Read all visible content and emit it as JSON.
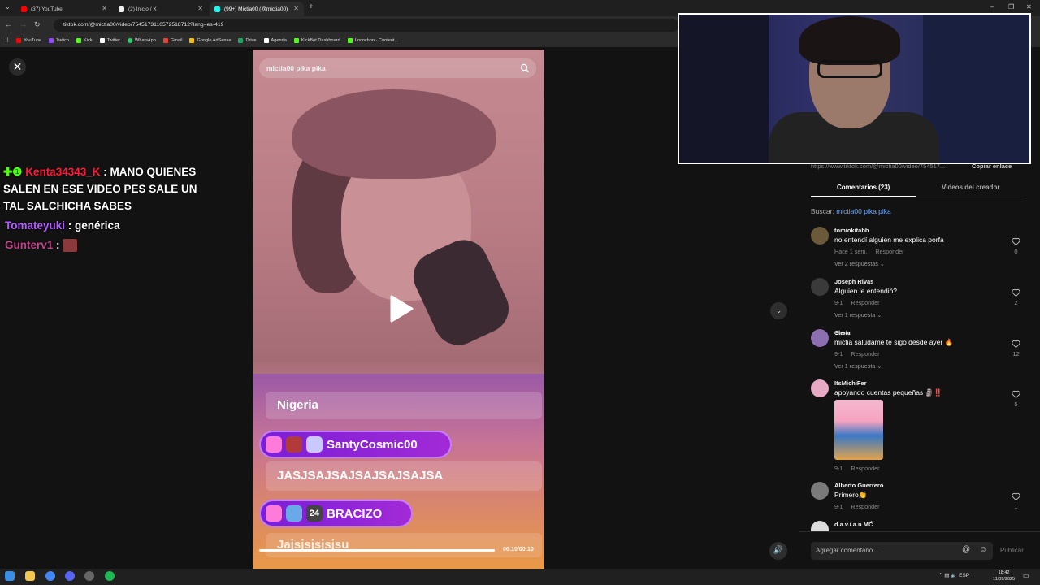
{
  "browser": {
    "tabs": [
      {
        "label": "(37) YouTube",
        "color": "#ff0000",
        "active": false
      },
      {
        "label": "(2) Inicio / X",
        "color": "#ffffff",
        "active": false
      },
      {
        "label": "(99+) Mictia00 (@mictia00)",
        "color": "#25f4ee",
        "active": true
      }
    ],
    "new_tab": "+",
    "url": "tiktok.com/@mictia00/video/7545173110572518712?lang=es-419",
    "bookmarks": [
      {
        "label": "YouTube",
        "color": "#ff0000"
      },
      {
        "label": "Twitch",
        "color": "#9146ff"
      },
      {
        "label": "Kick",
        "color": "#53fc18"
      },
      {
        "label": "Twitter",
        "color": "#ffffff"
      },
      {
        "label": "WhatsApp",
        "color": "#25d366"
      },
      {
        "label": "Gmail",
        "color": "#ea4335"
      },
      {
        "label": "Google AdSense",
        "color": "#fbbc04"
      },
      {
        "label": "Drive",
        "color": "#1fa463"
      },
      {
        "label": "Agenda",
        "color": "#ffffff"
      },
      {
        "label": "KickBot Dashboard",
        "color": "#53fc18"
      },
      {
        "label": "Locochon · Content...",
        "color": "#53fc18"
      }
    ]
  },
  "chat": [
    {
      "user": "Kenta34343_K",
      "user_color": "#ff1a3c",
      "text": ": MANO QUIENES",
      "badges": "✚❶"
    },
    {
      "user": "",
      "user_color": "#ffffff",
      "text": "SALEN EN ESE VIDEO PES SALE UN"
    },
    {
      "user": "",
      "user_color": "#ffffff",
      "text": "TAL SALCHICHA SABES"
    },
    {
      "user": "Tomateyuki",
      "user_color": "#b25cff",
      "text": ": genérica"
    },
    {
      "user": "Gunterv1",
      "user_color": "#c0468d",
      "text": ":"
    }
  ],
  "video": {
    "search_text": "mictia00 pika pika",
    "alert_messages": [
      {
        "type": "text",
        "text": "Nigeria"
      },
      {
        "type": "user",
        "text": "SantyCosmic00"
      },
      {
        "type": "text",
        "text": "JASJSAJSAJSAJSAJSAJSA"
      },
      {
        "type": "user",
        "text": "BRACIZO",
        "badge_text": "24"
      },
      {
        "type": "text",
        "text": "Jajsjsjsjsjsu"
      }
    ],
    "time": "00:10/00:10",
    "progress": 1.0
  },
  "panel": {
    "link": "https://www.tiktok.com/@mictia00/video/754517...",
    "copy_link": "Copiar enlace",
    "tab_comments": "Comentarios (23)",
    "tab_creator": "Videos del creador",
    "search_label": "Buscar: ",
    "search_term": "mictia00 pika pika",
    "comments": [
      {
        "user": "tomiokitabb",
        "text": "no entendí alguien me explica porfa",
        "date": "Hace 1 sem.",
        "reply": "Responder",
        "replies": "Ver 2 respuestas ⌄",
        "likes": "0",
        "avatar": "#6b5a3a"
      },
      {
        "user": "Joseph Rivas",
        "text": "Alguien le entendió?",
        "date": "9-1",
        "reply": "Responder",
        "replies": "Ver 1 respuesta ⌄",
        "likes": "2",
        "avatar": "#3a3a3a"
      },
      {
        "user": "𝕾𝖎𝖊𝖘𝖙𝖆",
        "text": "mictia salúdame te sigo desde ayer 🔥",
        "date": "9-1",
        "reply": "Responder",
        "replies": "Ver 1 respuesta ⌄",
        "likes": "12",
        "avatar": "#8c6fb0"
      },
      {
        "user": "ItsMichiFer",
        "text": "apoyando cuentas pequeñas 🗿‼️",
        "date": "9-1",
        "reply": "Responder",
        "replies": "",
        "likes": "5",
        "avatar": "#e7a9c4"
      },
      {
        "user": "Alberto Guerrero",
        "text": "Primero👏",
        "date": "9-1",
        "reply": "Responder",
        "replies": "",
        "likes": "1",
        "avatar": "#7a7a7a"
      },
      {
        "user": "d.a.v.i.a.n MĆ",
        "text": "",
        "date": "",
        "reply": "",
        "replies": "",
        "likes": "",
        "avatar": "#ddd"
      }
    ],
    "comment_placeholder": "Agregar comentario...",
    "publish": "Publicar"
  },
  "taskbar": {
    "lang": "ESP",
    "time": "18:42",
    "date": "11/09/2025"
  }
}
